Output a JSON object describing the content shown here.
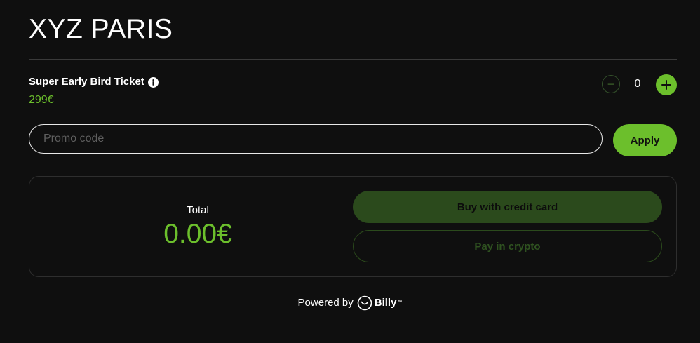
{
  "event": {
    "title": "XYZ PARIS"
  },
  "ticket": {
    "name": "Super Early Bird Ticket",
    "price": "299€",
    "quantity": "0",
    "minus_symbol": "−",
    "info_icon": "info-icon",
    "plus_icon": "plus-icon"
  },
  "promo": {
    "placeholder": "Promo code",
    "value": "",
    "apply_label": "Apply"
  },
  "summary": {
    "total_label": "Total",
    "total_value": "0.00€",
    "buy_card_label": "Buy with credit card",
    "pay_crypto_label": "Pay in crypto"
  },
  "footer": {
    "powered_by": "Powered by",
    "brand": "Billy",
    "brand_mark": "™",
    "logo_icon": "billy-smile-icon"
  },
  "colors": {
    "background": "#0f0f0f",
    "accent": "#6cbf2c",
    "accent_dim": "#2b4a1c",
    "text": "#ffffff",
    "border": "#2e2e2e"
  }
}
